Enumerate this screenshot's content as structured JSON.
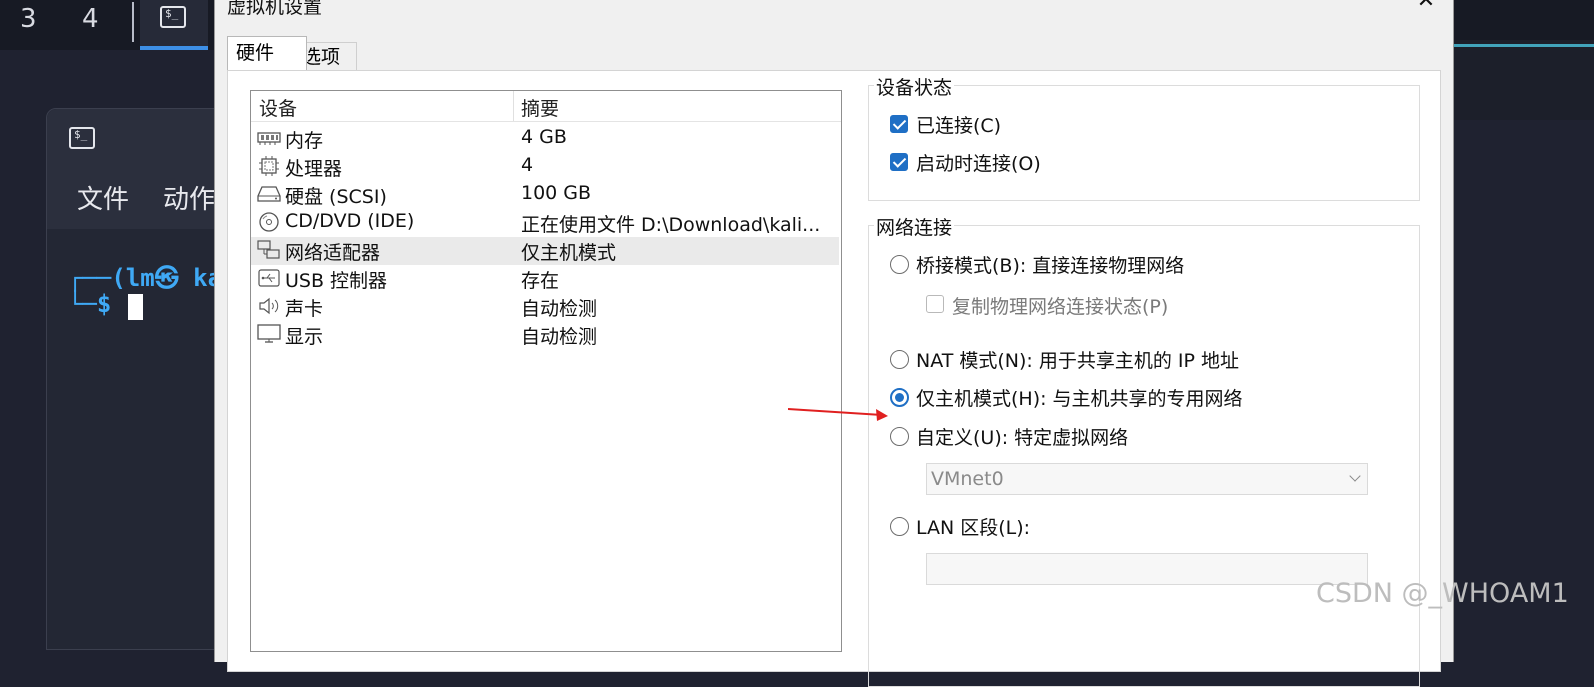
{
  "background": {
    "workspace_numbers": [
      "3",
      "4"
    ],
    "menu": [
      "文件",
      "动作"
    ],
    "prompt_line1": "┌──(lm㉿ ka",
    "prompt_line2": "└─$"
  },
  "dialog": {
    "title": "虚拟机设置",
    "close_label": "✕",
    "tabs": [
      {
        "label": "硬件",
        "active": true
      },
      {
        "label": "选项",
        "active": false
      }
    ]
  },
  "device_list": {
    "headers": {
      "device": "设备",
      "summary": "摘要"
    },
    "rows": [
      {
        "icon": "memory-icon",
        "name": "内存",
        "summary": "4 GB",
        "selected": false
      },
      {
        "icon": "processor-icon",
        "name": "处理器",
        "summary": "4",
        "selected": false
      },
      {
        "icon": "hard-disk-icon",
        "name": "硬盘 (SCSI)",
        "summary": "100 GB",
        "selected": false
      },
      {
        "icon": "cd-dvd-icon",
        "name": "CD/DVD (IDE)",
        "summary": "正在使用文件 D:\\Download\\kali...",
        "selected": false
      },
      {
        "icon": "network-adapter-icon",
        "name": "网络适配器",
        "summary": "仅主机模式",
        "selected": true
      },
      {
        "icon": "usb-icon",
        "name": "USB 控制器",
        "summary": "存在",
        "selected": false
      },
      {
        "icon": "sound-card-icon",
        "name": "声卡",
        "summary": "自动检测",
        "selected": false
      },
      {
        "icon": "display-icon",
        "name": "显示",
        "summary": "自动检测",
        "selected": false
      }
    ]
  },
  "device_status": {
    "title": "设备状态",
    "connected": {
      "label": "已连接(C)",
      "checked": true
    },
    "connect_at_power_on": {
      "label": "启动时连接(O)",
      "checked": true
    }
  },
  "network_connection": {
    "title": "网络连接",
    "bridged": {
      "label": "桥接模式(B): 直接连接物理网络",
      "selected": false
    },
    "replicate": {
      "label": "复制物理网络连接状态(P)",
      "checked": false,
      "enabled": false
    },
    "nat": {
      "label": "NAT 模式(N): 用于共享主机的 IP 地址",
      "selected": false
    },
    "host_only": {
      "label": "仅主机模式(H): 与主机共享的专用网络",
      "selected": true
    },
    "custom": {
      "label": "自定义(U): 特定虚拟网络",
      "selected": false
    },
    "custom_network_value": "VMnet0",
    "lan_segment": {
      "label": "LAN 区段(L):",
      "selected": false
    },
    "lan_segment_value": ""
  },
  "watermark": "CSDN @_WHOAM1",
  "colors": {
    "accent": "#1f6fc5",
    "annotation_arrow": "#e02020",
    "terminal_prompt": "#3fa9f5"
  }
}
